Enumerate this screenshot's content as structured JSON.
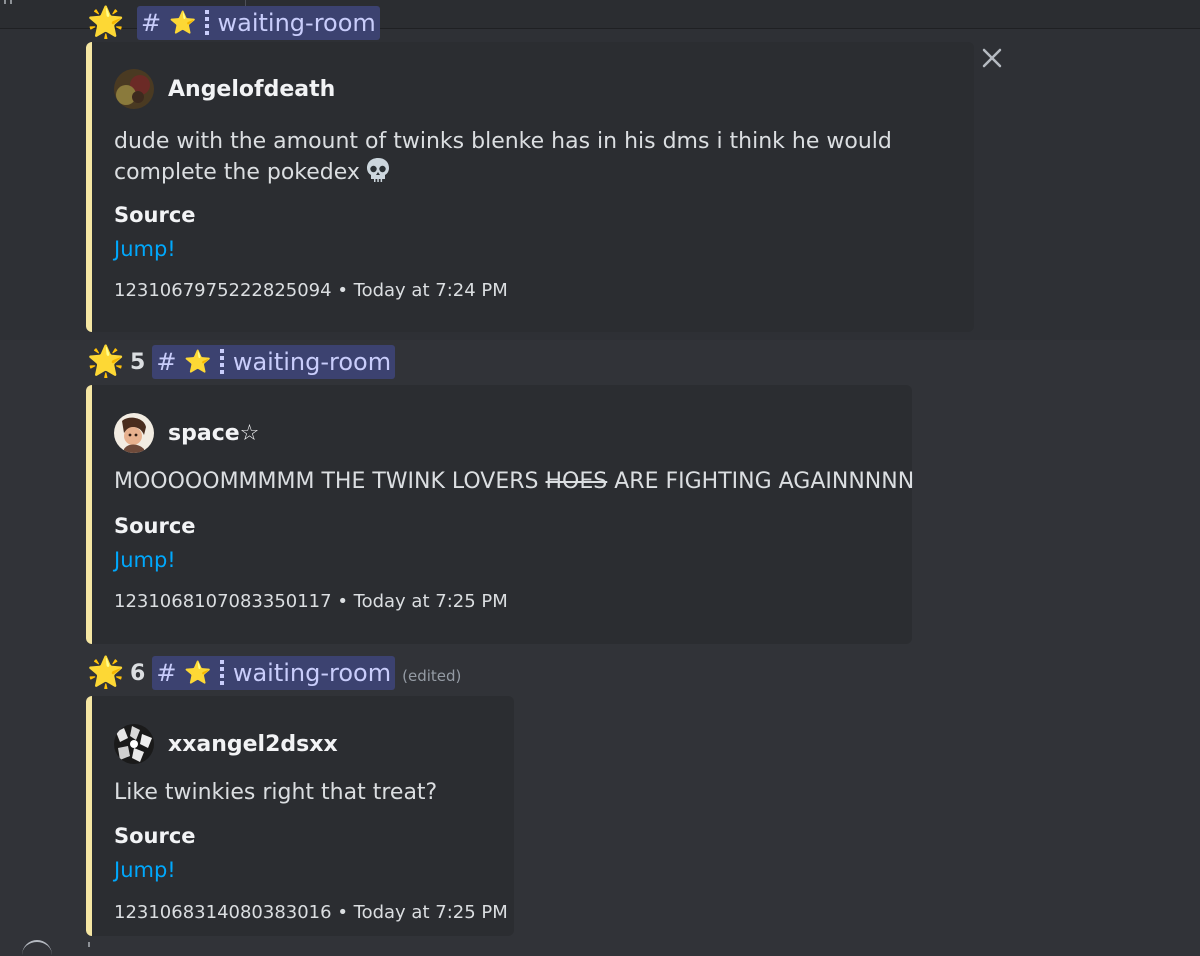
{
  "channel": {
    "name": "waiting-room",
    "hash": "#",
    "star_glyph": "⭐",
    "sun_glyph": "🌟"
  },
  "entries": [
    {
      "count": "",
      "author": "Angelofdeath",
      "text": "dude with the amount of twinks blenke has in his dms i think he would complete the pokedex",
      "has_skull": true,
      "field_name": "Source",
      "field_value": "Jump!",
      "footer": "1231067975222825094 • Today at 7:24 PM"
    },
    {
      "count": "5",
      "author": "space☆",
      "text_before": "MOOOOOMMMMM THE TWINK LOVERS ",
      "text_struck": "HOES",
      "text_after": " ARE FIGHTING AGAINNNNN",
      "field_name": "Source",
      "field_value": "Jump!",
      "footer": "1231068107083350117 • Today at 7:25 PM"
    },
    {
      "count": "6",
      "edited": "(edited)",
      "author": "xxangel2dsxx",
      "text": "Like twinkies right that treat?",
      "field_name": "Source",
      "field_value": "Jump!",
      "footer": "1231068314080383016 • Today at 7:25 PM"
    }
  ],
  "colors": {
    "background": "#313338",
    "embed_bg": "#2b2d31",
    "embed_border": "#f5e6a3",
    "link": "#00a8fc",
    "channel_pill": "#3c4270",
    "channel_text": "#c9cdfb"
  },
  "icons": [
    "glowing-star-icon",
    "star-icon",
    "close-icon",
    "skull-icon"
  ]
}
